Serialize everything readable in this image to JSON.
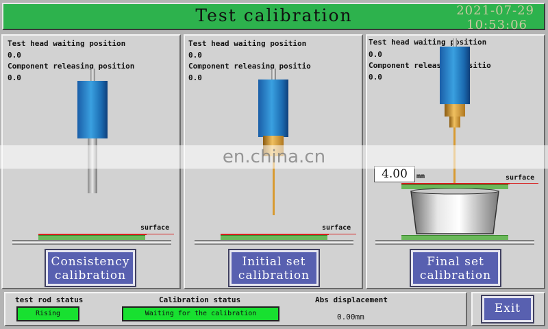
{
  "header": {
    "title": "Test calibration",
    "date": "2021-07-29",
    "time": "10:53:06"
  },
  "panels": [
    {
      "waiting_label": "Test head waiting position",
      "waiting_value": "0.0",
      "release_label": "Component releasing position",
      "release_value": "0.0",
      "surface_label": "surface",
      "button_line1": "Consistency",
      "button_line2": "calibration"
    },
    {
      "waiting_label": "Test head waiting position",
      "waiting_value": "0.0",
      "release_label": "Component releasing positio",
      "release_value": "0.0",
      "surface_label": "surface",
      "button_line1": "Initial set",
      "button_line2": "calibration"
    },
    {
      "waiting_label": "Test head waiting position",
      "waiting_value": "0.0",
      "release_label": "Component releasing positio",
      "release_value": "0.0",
      "surface_label": "surface",
      "displacement_value": "4.00",
      "displacement_unit": "mm",
      "button_line1": "Final set",
      "button_line2": "calibration"
    }
  ],
  "footer": {
    "rod_status_label": "test rod status",
    "rod_status_value": "Rising",
    "calibration_status_label": "Calibration status",
    "calibration_status_value": "Waiting for the calibration",
    "abs_displacement_label": "Abs displacement",
    "abs_displacement_value": "0.00mm",
    "exit_label": "Exit"
  },
  "watermark": "en.china.cn",
  "colors": {
    "title_bar": "#2db24d",
    "button": "#5860b0",
    "status_green": "#18e030",
    "rod_blue": "#2a8ad0",
    "brass": "#d89a30",
    "surface_red": "#d82020"
  }
}
